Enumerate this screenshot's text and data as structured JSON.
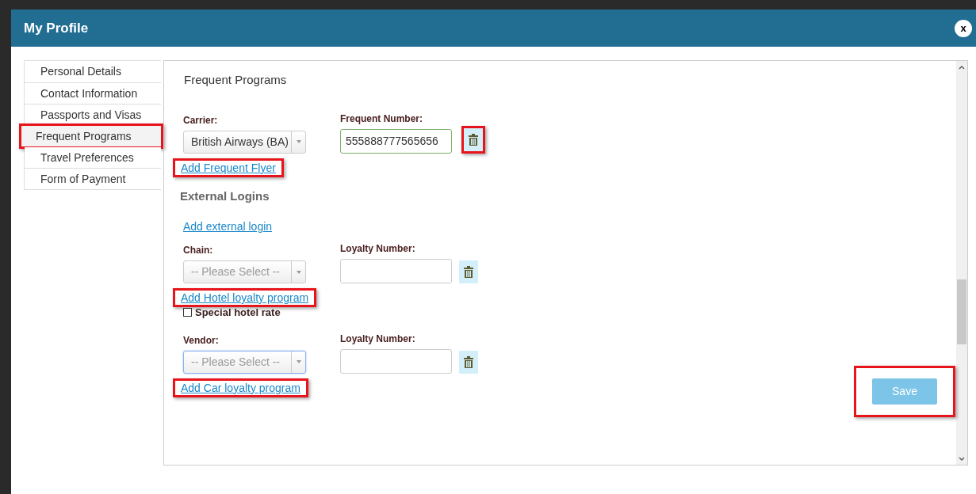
{
  "window": {
    "title": "My Profile",
    "close": "x"
  },
  "sidebar": {
    "items": [
      {
        "label": "Personal Details",
        "selected": false,
        "highlighted": false
      },
      {
        "label": "Contact Information",
        "selected": false,
        "highlighted": false
      },
      {
        "label": "Passports and Visas",
        "selected": false,
        "highlighted": false
      },
      {
        "label": "Frequent Programs",
        "selected": true,
        "highlighted": true
      },
      {
        "label": "Travel Preferences",
        "selected": false,
        "highlighted": false
      },
      {
        "label": "Form of Payment",
        "selected": false,
        "highlighted": false
      }
    ]
  },
  "content": {
    "blocks": [
      {
        "kind": "title",
        "text": "Frequent Programs"
      },
      {
        "kind": "program",
        "select_label": "Carrier:",
        "select_value": "British Airways (BA)",
        "select_focused": false,
        "number_label": "Frequent Number:",
        "number_value": "555888777565656",
        "number_valid": true,
        "delete_highlighted": true
      },
      {
        "kind": "link",
        "text": "Add Frequent Flyer",
        "highlighted": true
      },
      {
        "kind": "subheading",
        "text": "External Logins"
      },
      {
        "kind": "link",
        "text": "Add external login",
        "highlighted": false
      },
      {
        "kind": "program",
        "select_label": "Chain:",
        "select_placeholder": "-- Please Select --",
        "select_focused": false,
        "number_label": "Loyalty Number:",
        "number_valid": false,
        "delete_highlighted": false
      },
      {
        "kind": "link",
        "text": "Add Hotel loyalty program",
        "highlighted": true
      },
      {
        "kind": "checkbox",
        "label": "Special hotel rate",
        "checked": false
      },
      {
        "kind": "program",
        "select_label": "Vendor:",
        "select_placeholder": "-- Please Select --",
        "select_focused": true,
        "number_label": "Loyalty Number:",
        "number_valid": false,
        "delete_highlighted": false
      },
      {
        "kind": "link",
        "text": "Add Car loyalty program",
        "highlighted": true
      }
    ]
  },
  "save_button": {
    "label": "Save",
    "disabled": true,
    "highlighted": true
  }
}
